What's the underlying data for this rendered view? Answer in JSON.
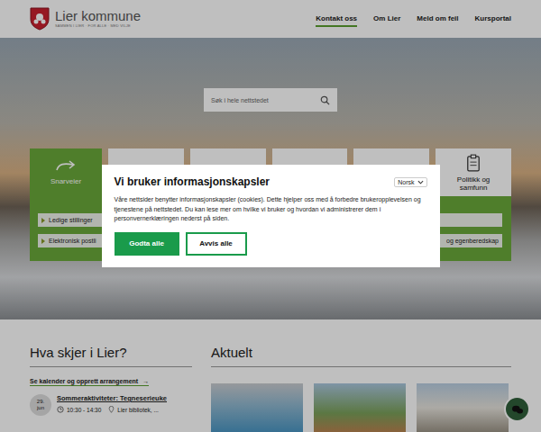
{
  "header": {
    "logo_title": "Lier kommune",
    "tagline": "SAMMEN I LIER · FOR ALLE · MED VILJE",
    "nav": [
      {
        "label": "Kontakt oss",
        "selected": true
      },
      {
        "label": "Om Lier",
        "selected": false
      },
      {
        "label": "Meld om feil",
        "selected": false
      },
      {
        "label": "Kursportal",
        "selected": false
      }
    ]
  },
  "search": {
    "placeholder": "Søk i hele nettstedet"
  },
  "tiles": [
    {
      "label": "Snarveier",
      "selected": true
    },
    {
      "label": "",
      "selected": false
    },
    {
      "label": "",
      "selected": false
    },
    {
      "label": "",
      "selected": false
    },
    {
      "label": "",
      "selected": false
    },
    {
      "label": "Politikk og samfunn",
      "selected": false
    }
  ],
  "shortcut_links": {
    "left": [
      "Ledige stillinger",
      "Elektronisk postli"
    ],
    "right": [
      "",
      "og egenberedskap"
    ]
  },
  "events": {
    "title": "Hva skjer i Lier?",
    "calendar_link": "Se kalender og opprett arrangement",
    "link_arrow": "→",
    "items": [
      {
        "day": "29.",
        "month": "jun",
        "title": "Sommeraktiviteter: Tegneserieuke",
        "time": "10:30 - 14:30",
        "place": "Lier bibliotek, ..."
      }
    ]
  },
  "news": {
    "title": "Aktuelt",
    "cards": [
      {
        "kind": "pool"
      },
      {
        "kind": "park"
      },
      {
        "kind": "building"
      }
    ]
  },
  "cookie_dialog": {
    "title": "Vi bruker informasjonskapsler",
    "language": "Norsk",
    "text": "Våre nettsider benytter informasjonskapsler (cookies). Dette hjelper oss med å forbedre brukeropplevelsen og tjenestene på nettstedet. Du kan lese mer om hvilke vi bruker og hvordan vi administrerer dem i personvernerklæringen nederst på siden.",
    "buttons": [
      {
        "label": "Godta alle",
        "kind": "primary"
      },
      {
        "label": "Avvis alle",
        "kind": "outline"
      }
    ]
  }
}
